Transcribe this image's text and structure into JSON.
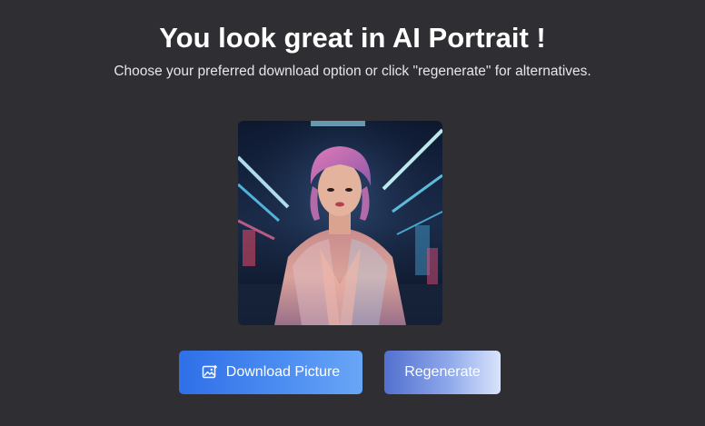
{
  "header": {
    "title": "You look great in AI Portrait !",
    "subtitle": "Choose your preferred download option or click \"regenerate\" for alternatives."
  },
  "portrait": {
    "alt_icon": "portrait-image"
  },
  "actions": {
    "download_label": "Download Picture",
    "download_icon": "image-icon",
    "regenerate_label": "Regenerate"
  },
  "colors": {
    "background": "#2f2f33",
    "download_start": "#2f6fe8",
    "download_end": "#6aa6f6",
    "regenerate_start": "#5270cf",
    "regenerate_end": "#d9e4fb"
  }
}
